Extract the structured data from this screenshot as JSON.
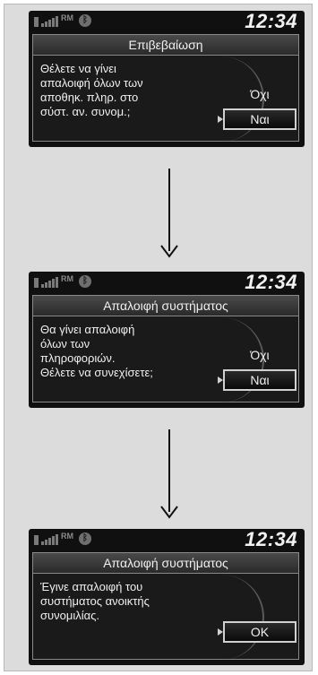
{
  "screens": [
    {
      "status": {
        "rm": "RM",
        "clock": "12:34"
      },
      "title": "Επιβεβαίωση",
      "message": "Θέλετε να γίνει\nαπαλοιφή όλων των\nαποθηκ. πληρ. στο\nσύστ. αν. συνομ.;",
      "options": [
        "Όχι",
        "Ναι"
      ],
      "selected": 1
    },
    {
      "status": {
        "rm": "RM",
        "clock": "12:34"
      },
      "title": "Απαλοιφή συστήματος",
      "message": "Θα γίνει απαλοιφή\nόλων των\nπληροφοριών.\nΘέλετε να συνεχίσετε;",
      "options": [
        "Όχι",
        "Ναι"
      ],
      "selected": 1
    },
    {
      "status": {
        "rm": "RM",
        "clock": "12:34"
      },
      "title": "Απαλοιφή συστήματος",
      "message": "Έγινε απαλοιφή του\nσυστήματος ανοικτής\nσυνομιλίας.",
      "options": [
        "OK"
      ],
      "selected": 0
    }
  ],
  "icons": {
    "battery": "battery-icon",
    "signal": "signal-strength-icon",
    "bluetooth": "bluetooth-icon",
    "arrow": "arrow-down-icon"
  }
}
